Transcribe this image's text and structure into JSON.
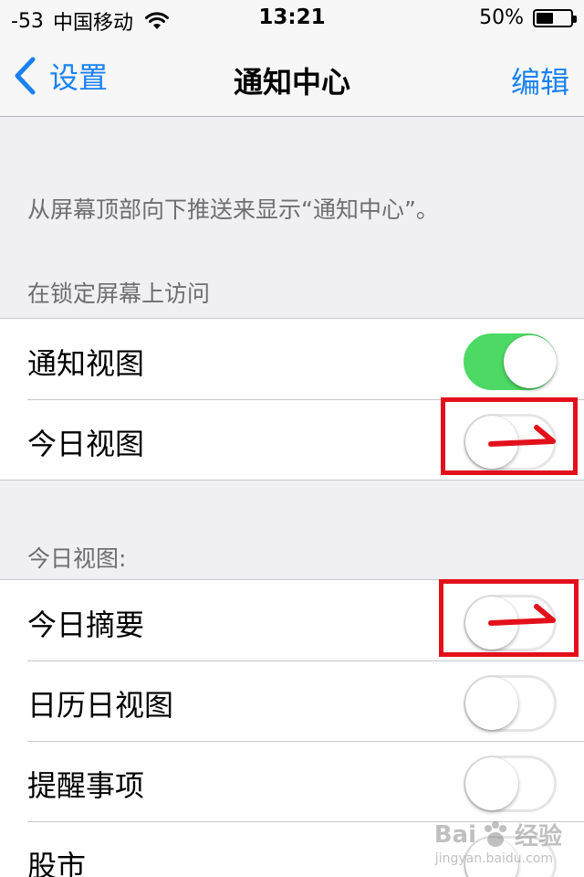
{
  "status_bar": {
    "signal": "-53",
    "carrier": "中国移动",
    "time": "13:21",
    "battery": "50%",
    "battery_level": 0.5
  },
  "nav": {
    "back_label": "设置",
    "title": "通知中心",
    "edit_label": "编辑"
  },
  "description": "从屏幕顶部向下推送来显示“通知中心”。",
  "lock_screen_section": {
    "header": "在锁定屏幕上访问",
    "rows": [
      {
        "label": "通知视图",
        "on": true
      },
      {
        "label": "今日视图",
        "on": false
      }
    ]
  },
  "today_section": {
    "header": "今日视图:",
    "rows": [
      {
        "label": "今日摘要",
        "on": false
      },
      {
        "label": "日历日视图",
        "on": false
      },
      {
        "label": "提醒事项",
        "on": false
      },
      {
        "label": "股市",
        "on": false
      }
    ]
  },
  "watermark": {
    "brand_left": "Bai",
    "brand_right": "经验",
    "url": "jingyan.baidu.com"
  },
  "colors": {
    "accent": "#1a82f0",
    "toggle_on": "#4cd964",
    "annotation": "#e3101b",
    "background": "#efeff4"
  },
  "icons": {
    "back": "chevron-left-icon",
    "wifi": "wifi-icon",
    "battery": "battery-icon"
  }
}
